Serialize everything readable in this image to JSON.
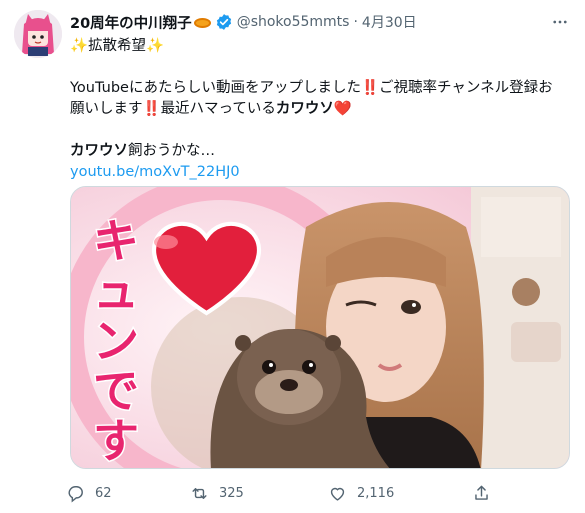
{
  "tweet": {
    "display_name": "20周年の中川翔子",
    "name_emoji": "ring-emoji",
    "verified_icon": "verified-badge-icon",
    "handle": "@shoko55mmts",
    "separator": "·",
    "date": "4月30日",
    "more_icon": "more-options-icon",
    "line1_pre": "✨",
    "line1_text": "拡散希望",
    "line1_post": "✨",
    "line2_text": "YouTubeにあたらしい動画をアップしました",
    "line2_bang": "‼️",
    "line2_rest": "ご視聴率チャンネル登録お",
    "line3_text": "願いします",
    "line3_bang": "‼️",
    "line3_rest": "最近ハマっている",
    "line3_bold": "カワウソ",
    "line3_heart": "❤️",
    "line4_bold": "カワウソ",
    "line4_rest": "飼おうかな…",
    "link": "youtu.be/moXvT_22HJ0",
    "thumbnail_text": "キュンです"
  },
  "actions": {
    "reply_count": "62",
    "retweet_count": "325",
    "like_count": "2,116"
  },
  "colors": {
    "link": "#1d9bf0",
    "muted": "#536471",
    "verified": "#1d9bf0",
    "heart": "#e0245e",
    "thumbnail_text": "#e8256f"
  }
}
